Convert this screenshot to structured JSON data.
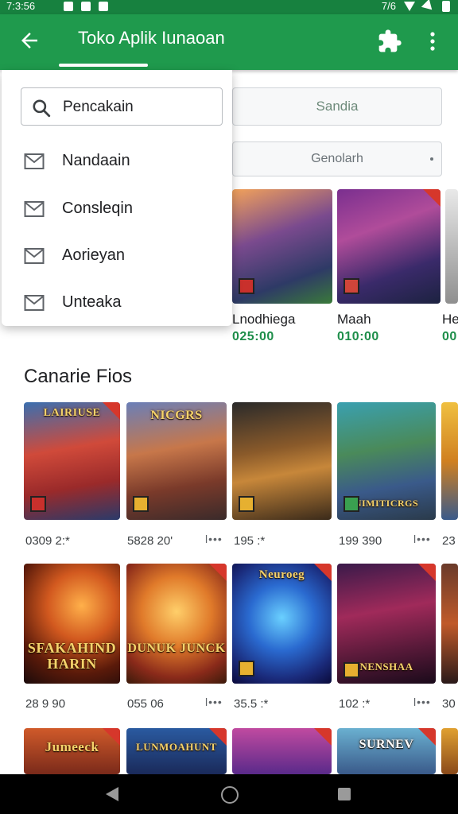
{
  "status_bar": {
    "time": "7:3:56",
    "right_text": "7/6"
  },
  "app_bar": {
    "title": "Toko Aplik Iunaoan"
  },
  "filters": {
    "search_placeholder": "Sandia",
    "select_value": "Genolarh"
  },
  "dropdown_menu": {
    "search_text": "Pencakain",
    "items": [
      {
        "label": "Nandaain"
      },
      {
        "label": "Consleqin"
      },
      {
        "label": "Aorieyan"
      },
      {
        "label": "Unteaka"
      }
    ]
  },
  "featured": [
    {
      "name": "Lnodhiega",
      "price": "025:00"
    },
    {
      "name": "Maah",
      "price": "010:00"
    },
    {
      "name": "He",
      "price": "00"
    }
  ],
  "section": {
    "title": "Canarie Fios"
  },
  "grid_row1": [
    {
      "title": "LAIRIUSE",
      "rating": "0309 2:*",
      "more": ""
    },
    {
      "title": "NICGRS",
      "rating": "5828 20'",
      "more": "l•••"
    },
    {
      "title": "",
      "rating": "195 :*",
      "more": ""
    },
    {
      "title": "NIMITICRGS",
      "rating": "199 390",
      "more": "l•••"
    },
    {
      "title": "",
      "rating": "23",
      "more": ""
    }
  ],
  "grid_row2": [
    {
      "title": "SFAKAHIND HARIN",
      "rating": "28 9 90",
      "more": ""
    },
    {
      "title": "DUNUK JUNCK",
      "rating": "055 06",
      "more": "l•••"
    },
    {
      "title": "Neuroeg",
      "rating": "35.5 :*",
      "more": ""
    },
    {
      "title": "NENSHAA",
      "rating": "102 :*",
      "more": "l•••"
    },
    {
      "title": "",
      "rating": "30",
      "more": ""
    }
  ],
  "grid_row3": [
    {
      "title": "Jumeeck"
    },
    {
      "title": "LUNMOAHUNT"
    },
    {
      "title": ""
    },
    {
      "title": "SURNEV"
    },
    {
      "title": ""
    }
  ],
  "colors": {
    "primary": "#1f9a4d",
    "status_bar": "#17813f",
    "price": "#1e8e4a"
  }
}
